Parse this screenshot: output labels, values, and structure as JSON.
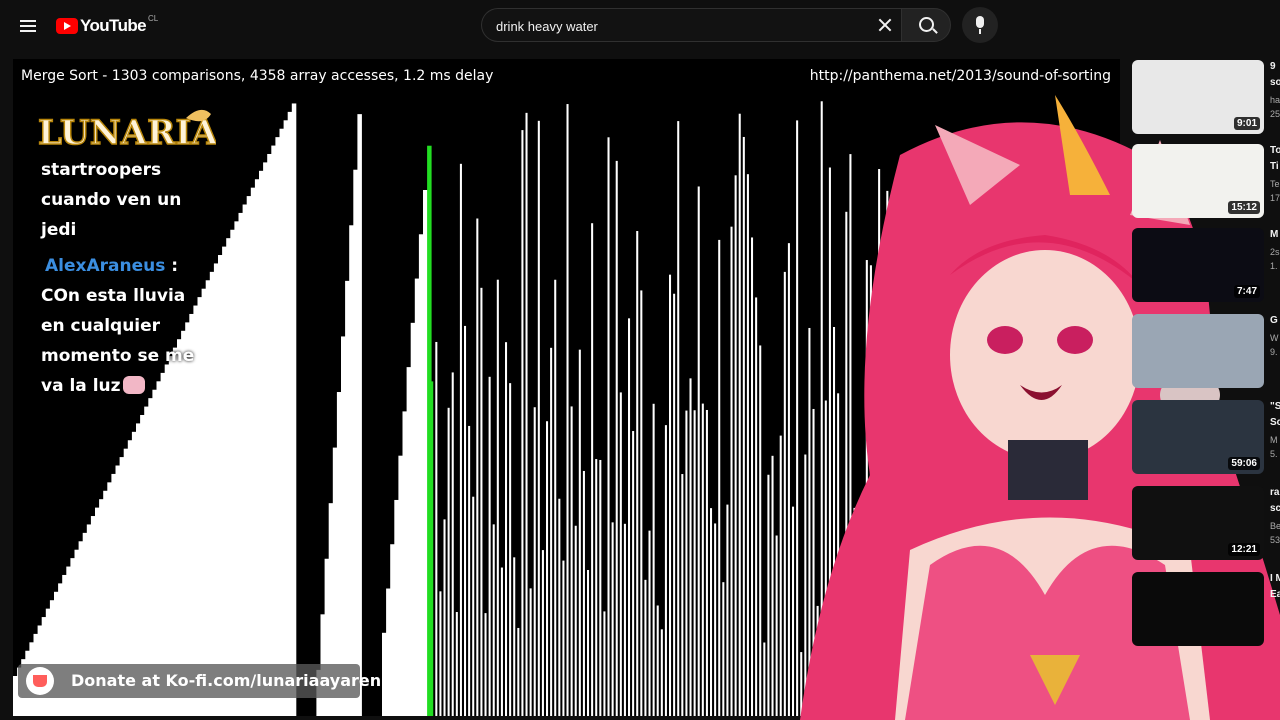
{
  "header": {
    "logo_text": "YouTube",
    "country_code": "CL",
    "search_value": "drink heavy water"
  },
  "video": {
    "caption_left": "Merge Sort - 1303 comparisons, 4358 array accesses, 1.2 ms delay",
    "caption_right": "http://panthema.net/2013/sound-of-sorting",
    "bar_colors": {
      "default": "#ffffff",
      "compare": "#ff0000",
      "cursor": "#22dd22"
    }
  },
  "overlay": {
    "channel_logo_text": "LUNARIA",
    "chat": [
      {
        "user": "",
        "text_lines": [
          "startroopers",
          "cuando ven un",
          "jedi"
        ]
      },
      {
        "user": "AlexAraneus",
        "text_lines": [
          "COn esta lluvia",
          "en cualquier",
          "momento se me",
          "va la luz"
        ]
      }
    ],
    "donate_text": "Donate at Ko-fi.com/lunariaayaren"
  },
  "sidebar": {
    "recommendations": [
      {
        "title": "9",
        "title2": "so",
        "meta": [
          "ha",
          "25"
        ],
        "duration": "9:01",
        "thumb_color": "#e8e8e8"
      },
      {
        "title": "To",
        "title2": "Ti",
        "meta": [
          "Te",
          "17"
        ],
        "duration": "15:12",
        "thumb_color": "#f2f2ee"
      },
      {
        "title": "M",
        "title2": "",
        "meta": [
          "2s",
          "1."
        ],
        "duration": "7:47",
        "thumb_color": "#0c0c14"
      },
      {
        "title": "G",
        "title2": "",
        "meta": [
          "W",
          "9."
        ],
        "duration": "",
        "thumb_color": "#9aa6b4"
      },
      {
        "title": "\"S",
        "title2": "Sc",
        "meta": [
          "M",
          "5."
        ],
        "duration": "59:06",
        "thumb_color": "#2b3440"
      },
      {
        "title": "ra",
        "title2": "sc",
        "meta": [
          "Be",
          "53"
        ],
        "duration": "12:21",
        "thumb_color": "#101010"
      },
      {
        "title": "I M",
        "title2": "Ea",
        "meta": [],
        "duration": "",
        "thumb_color": "#0a0a0a"
      }
    ]
  }
}
